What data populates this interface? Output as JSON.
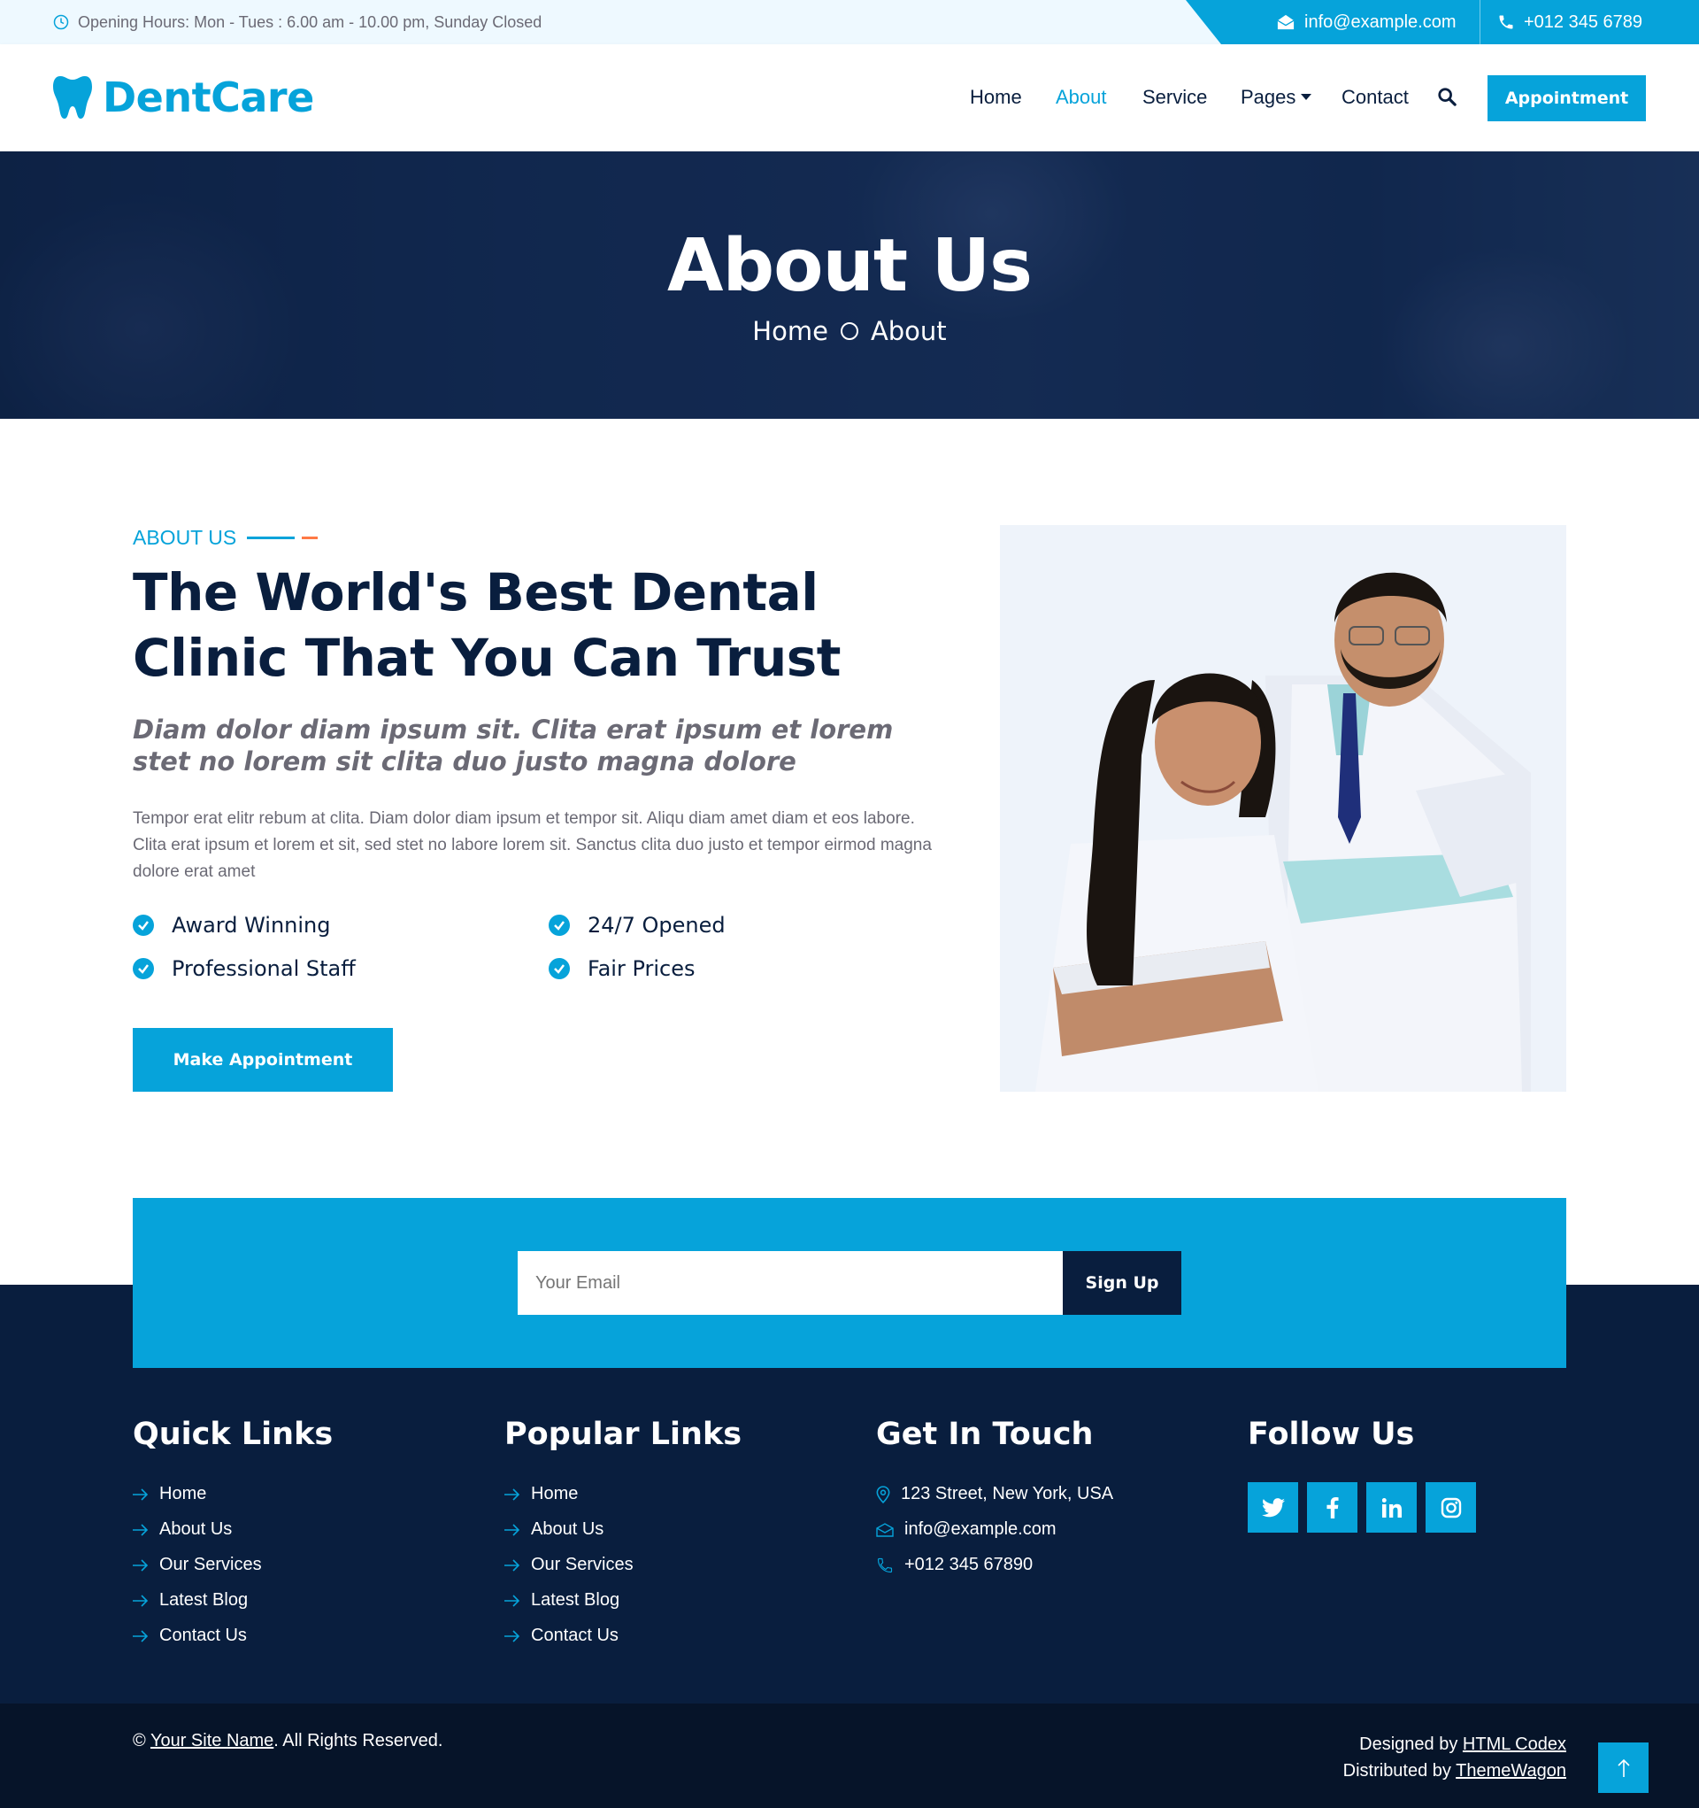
{
  "topbar": {
    "hours": "Opening Hours: Mon - Tues : 6.00 am - 10.00 pm, Sunday Closed",
    "email": "info@example.com",
    "phone": "+012 345 6789"
  },
  "brand": {
    "name": "DentCare"
  },
  "nav": {
    "items": [
      {
        "label": "Home"
      },
      {
        "label": "About",
        "active": true
      },
      {
        "label": "Service"
      },
      {
        "label": "Pages"
      },
      {
        "label": "Contact"
      }
    ],
    "appointment": "Appointment"
  },
  "hero": {
    "title": "About Us",
    "crumb_home": "Home",
    "crumb_current": "About"
  },
  "about": {
    "eyebrow": "ABOUT US",
    "title": "The World's Best Dental Clinic That You Can Trust",
    "lead": "Diam dolor diam ipsum sit. Clita erat ipsum et lorem stet no lorem sit clita duo justo magna dolore",
    "text": "Tempor erat elitr rebum at clita. Diam dolor diam ipsum et tempor sit. Aliqu diam amet diam et eos labore. Clita erat ipsum et lorem et sit, sed stet no labore lorem sit. Sanctus clita duo justo et tempor eirmod magna dolore erat amet",
    "features": [
      "Award Winning",
      "24/7 Opened",
      "Professional Staff",
      "Fair Prices"
    ],
    "button": "Make Appointment"
  },
  "newsletter": {
    "placeholder": "Your Email",
    "button": "Sign Up"
  },
  "footer": {
    "quick_title": "Quick Links",
    "quick_links": [
      "Home",
      "About Us",
      "Our Services",
      "Latest Blog",
      "Contact Us"
    ],
    "popular_title": "Popular Links",
    "popular_links": [
      "Home",
      "About Us",
      "Our Services",
      "Latest Blog",
      "Contact Us"
    ],
    "touch_title": "Get In Touch",
    "address": "123 Street, New York, USA",
    "email": "info@example.com",
    "phone": "+012 345 67890",
    "follow_title": "Follow Us",
    "social_icons": [
      "twitter-icon",
      "facebook-icon",
      "linkedin-icon",
      "instagram-icon"
    ]
  },
  "copyright": {
    "symbol": "©",
    "site_name": "Your Site Name",
    "rights": ". All Rights Reserved.",
    "designed_prefix": "Designed by",
    "designed_by": "HTML Codex",
    "distributed_prefix": "Distributed by",
    "distributed_by": "ThemeWagon"
  },
  "colors": {
    "primary": "#06a3da",
    "dark": "#091e3e",
    "accent": "#ff7a45"
  }
}
